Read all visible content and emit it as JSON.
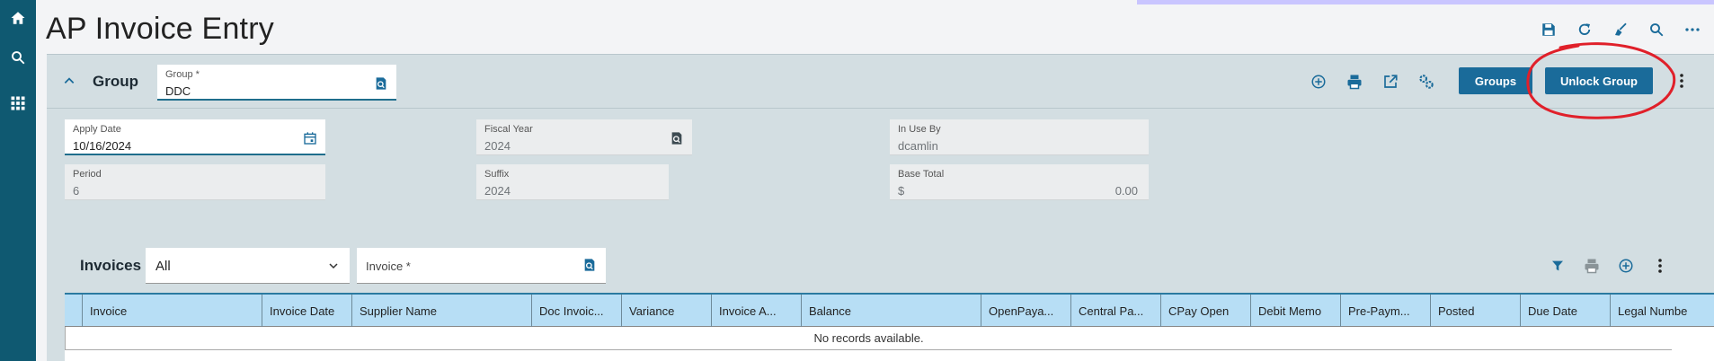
{
  "page": {
    "title": "AP Invoice Entry"
  },
  "colors": {
    "accent": "#1a6b9a",
    "rail": "#0f5971",
    "header_bg": "#b7def5",
    "panel_bg": "#d3dee2",
    "annotation": "#e0202a"
  },
  "rail": {
    "icons": [
      "home-icon",
      "search-icon",
      "apps-grid-icon"
    ]
  },
  "toolbar_icons": [
    "save-icon",
    "refresh-icon",
    "clear-icon",
    "search-icon",
    "more-icon"
  ],
  "group": {
    "label": "Group",
    "field_label": "Group *",
    "field_value": "DDC",
    "buttons": {
      "groups": "Groups",
      "unlock": "Unlock Group"
    },
    "action_icons": [
      "add-icon",
      "print-icon",
      "open-external-icon",
      "settings-icon"
    ]
  },
  "fields": {
    "apply_date": {
      "label": "Apply Date",
      "value": "10/16/2024"
    },
    "fiscal_year": {
      "label": "Fiscal Year",
      "value": "2024"
    },
    "in_use_by": {
      "label": "In Use By",
      "value": "dcamlin"
    },
    "period": {
      "label": "Period",
      "value": "6"
    },
    "suffix": {
      "label": "Suffix",
      "value": "2024"
    },
    "base_total": {
      "label": "Base Total",
      "currency": "$",
      "value": "0.00"
    }
  },
  "invoices": {
    "label": "Invoices",
    "filter_value": "All",
    "search_placeholder": "Invoice *",
    "columns": [
      "Invoice",
      "Invoice Date",
      "Supplier Name",
      "Doc Invoic...",
      "Variance",
      "Invoice A...",
      "Balance",
      "OpenPaya...",
      "Central Pa...",
      "CPay Open",
      "Debit Memo",
      "Pre-Paym...",
      "Posted",
      "Due Date",
      "Legal Numbe"
    ],
    "empty_text": "No records available."
  }
}
